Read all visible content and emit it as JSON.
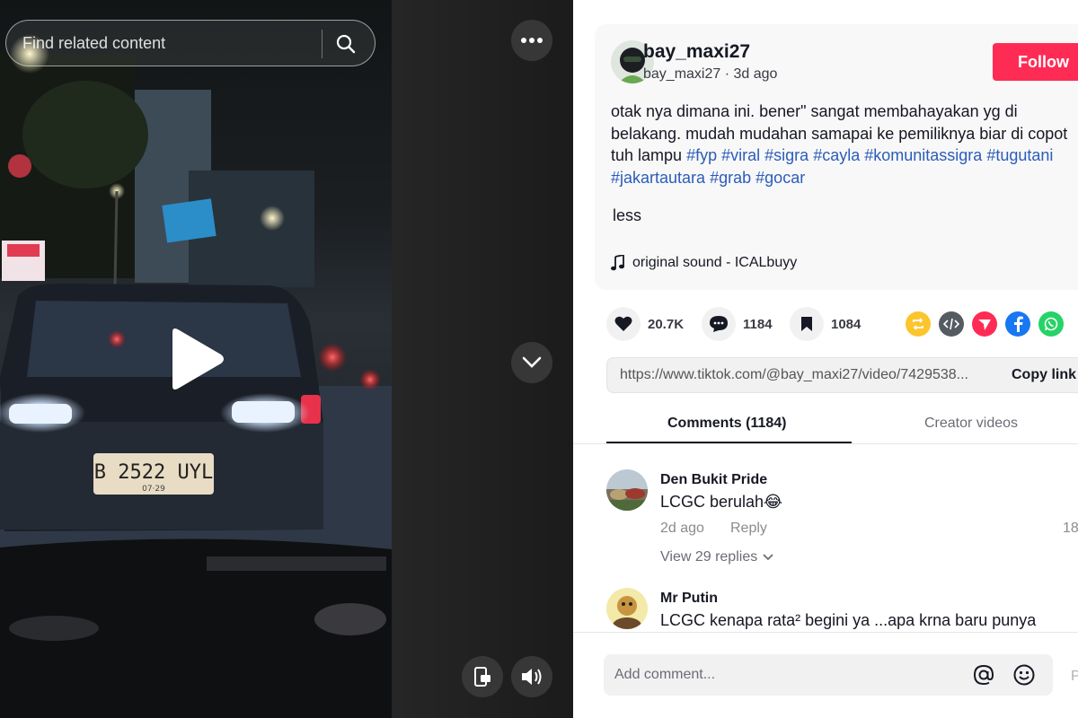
{
  "video": {
    "search_placeholder": "Find related content",
    "license_plate": "B 2522 UYL",
    "license_sub": "07·29",
    "icons": [
      "search-icon",
      "more-icon",
      "play-icon",
      "chevron-down-icon",
      "rotate-screen-icon",
      "volume-icon"
    ]
  },
  "author": {
    "username": "bay_maxi27",
    "handle": "bay_maxi27",
    "posted": "3d ago",
    "follow_label": "Follow"
  },
  "caption": {
    "text": "otak nya dimana ini. bener\" sangat membahayakan yg di belakang. mudah mudahan samapai ke pemiliknya biar di copot tuh lampu ",
    "hashtags": [
      "#fyp",
      "#viral",
      "#sigra",
      "#cayla",
      "#komunitassigra",
      "#tugutani",
      "#jakartautara",
      "#grab",
      "#gocar"
    ],
    "less_label": "less"
  },
  "sound": {
    "label": "original sound - ICALbuyy"
  },
  "actions": {
    "likes": "20.7K",
    "comments": "1184",
    "saves": "1084"
  },
  "share_colors": {
    "repost": "#fcc52d",
    "embed": "#555b61",
    "send": "#fe2c55",
    "facebook": "#1877f2",
    "whatsapp": "#25d366"
  },
  "link": {
    "url": "https://www.tiktok.com/@bay_maxi27/video/7429538...",
    "copy_label": "Copy link"
  },
  "tabs": {
    "comments": "Comments (1184)",
    "creator": "Creator videos"
  },
  "comments": [
    {
      "name": "Den Bukit Pride",
      "text": "LCGC berulah😂",
      "time": "2d ago",
      "reply": "Reply",
      "view_replies": "View 29 replies",
      "side": "18"
    },
    {
      "name": "Mr Putin",
      "text": "LCGC kenapa rata² begini ya ...apa krna baru punya"
    }
  ],
  "composer": {
    "placeholder": "Add comment...",
    "post": "P"
  },
  "colors": {
    "accent": "#fe2c55",
    "hashtag": "#2b5db9"
  }
}
